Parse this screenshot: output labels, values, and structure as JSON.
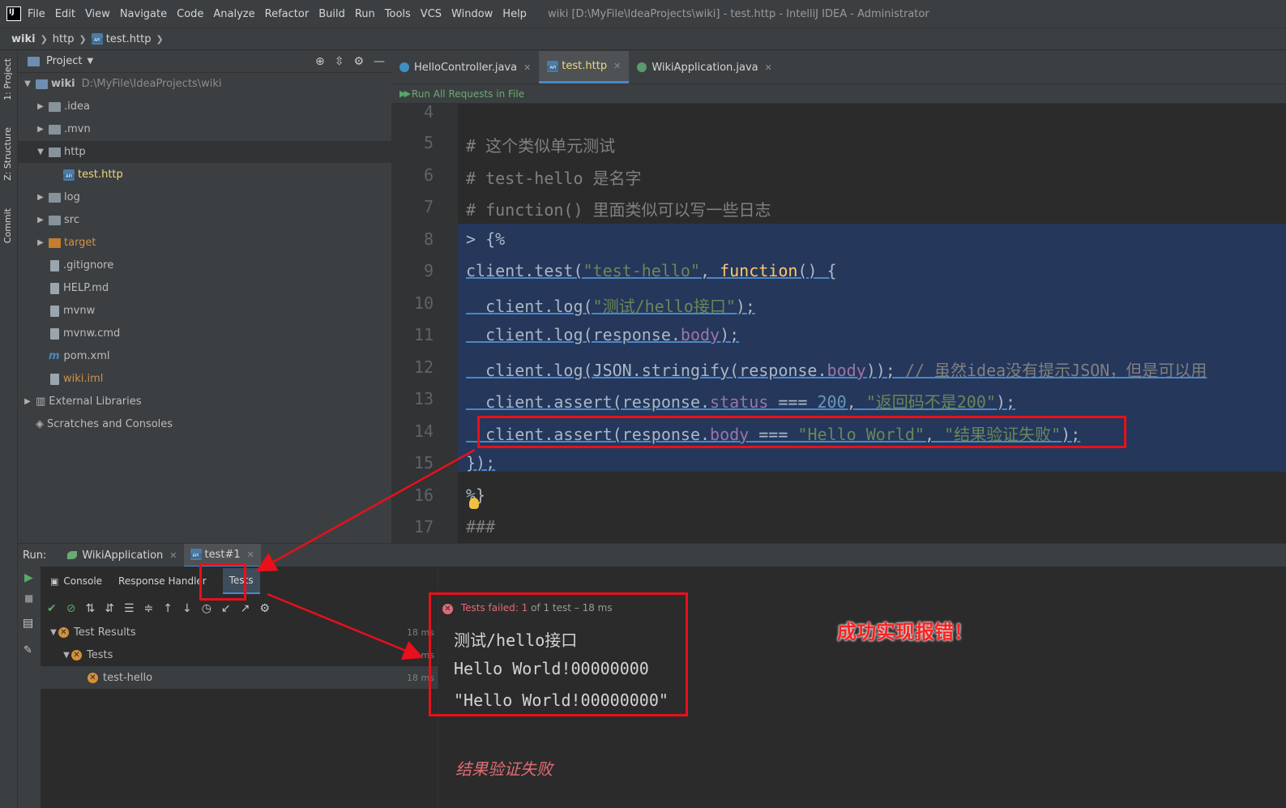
{
  "menubar": {
    "items": [
      "File",
      "Edit",
      "View",
      "Navigate",
      "Code",
      "Analyze",
      "Refactor",
      "Build",
      "Run",
      "Tools",
      "VCS",
      "Window",
      "Help"
    ],
    "window_title": "wiki [D:\\MyFile\\IdeaProjects\\wiki] - test.http - IntelliJ IDEA - Administrator"
  },
  "breadcrumb": [
    "wiki",
    "http",
    "test.http"
  ],
  "toolstrip": [
    "1: Project",
    "Z: Structure",
    "Commit"
  ],
  "project": {
    "title": "Project",
    "tree": [
      {
        "label": "wiki",
        "extra": "D:\\MyFile\\IdeaProjects\\wiki"
      },
      {
        "label": ".idea"
      },
      {
        "label": ".mvn"
      },
      {
        "label": "http"
      },
      {
        "label": "test.http"
      },
      {
        "label": "log"
      },
      {
        "label": "src"
      },
      {
        "label": "target"
      },
      {
        "label": ".gitignore"
      },
      {
        "label": "HELP.md"
      },
      {
        "label": "mvnw"
      },
      {
        "label": "mvnw.cmd"
      },
      {
        "label": "pom.xml"
      },
      {
        "label": "wiki.iml"
      },
      {
        "label": "External Libraries"
      },
      {
        "label": "Scratches and Consoles"
      }
    ]
  },
  "editor": {
    "tabs": [
      "HelloController.java",
      "test.http",
      "WikiApplication.java"
    ],
    "run_all": "Run All Requests in File",
    "line_numbers": [
      "4",
      "5",
      "6",
      "7",
      "8",
      "9",
      "10",
      "11",
      "12",
      "13",
      "14",
      "15",
      "16",
      "17"
    ],
    "lines": {
      "l5": "# 这个类似单元测试",
      "l6": "# test-hello 是名字",
      "l7": "# function() 里面类似可以写一些日志",
      "l8": "> {%",
      "l9a": "client.test(",
      "l9b": "\"test-hello\"",
      "l9c": ", ",
      "l9d": "function",
      "l9e": "() {",
      "l10a": "  client.log(",
      "l10b": "\"测试/hello接口\"",
      "l10c": ");",
      "l11a": "  client.log(response.",
      "l11b": "body",
      "l11c": ");",
      "l12a": "  client.log(JSON.stringify(response.",
      "l12b": "body",
      "l12c": ")); ",
      "l12d": "// 虽然idea没有提示JSON，但是可以用",
      "l13a": "  client.assert(response.",
      "l13b": "status",
      "l13c": " === ",
      "l13d": "200",
      "l13e": ", ",
      "l13f": "\"返回码不是200\"",
      "l13g": ");",
      "l14a": "  client.assert(response.",
      "l14b": "body",
      "l14c": " === ",
      "l14d": "\"Hello World\"",
      "l14e": ", ",
      "l14f": "\"结果验证失败\"",
      "l14g": ");",
      "l15": "});",
      "l16": "%}",
      "l17": "###"
    }
  },
  "run": {
    "label": "Run:",
    "tabs": [
      "WikiApplication",
      "test#1"
    ],
    "subtabs": [
      "Console",
      "Response Handler",
      "Tests"
    ],
    "tree": [
      {
        "label": "Test Results",
        "duration": "18 ms"
      },
      {
        "label": "Tests",
        "duration": "18 ms"
      },
      {
        "label": "test-hello",
        "duration": "18 ms"
      }
    ],
    "header_fail": "Tests failed: 1",
    "header_rest": "of 1 test – 18 ms",
    "output": [
      "测试/hello接口",
      "Hello World!00000000",
      "\"Hello World!00000000\""
    ],
    "fail_message": "结果验证失败"
  },
  "annotation": "成功实现报错！",
  "colors": {
    "annotation_red": "#e8101a",
    "selection": "#214283",
    "fail": "#e06c75"
  }
}
